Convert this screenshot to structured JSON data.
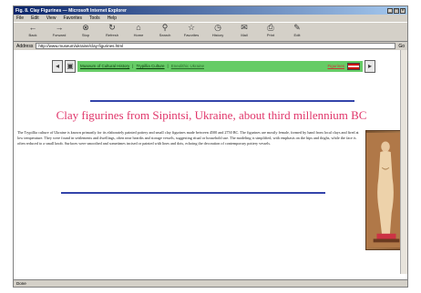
{
  "browser": {
    "title": "Fig. 8. Clay Figurines — Microsoft Internet Explorer",
    "menu": [
      "File",
      "Edit",
      "View",
      "Favorites",
      "Tools",
      "Help"
    ],
    "toolbar": [
      "Back",
      "Forward",
      "Stop",
      "Refresh",
      "Home",
      "Search",
      "Favorites",
      "History",
      "Mail",
      "Print",
      "Edit"
    ],
    "address_label": "Address",
    "address_value": "http://www.museum/ukraine/clay-figurines.html",
    "go_label": "Go",
    "status": "Done"
  },
  "page": {
    "nav": {
      "left_arrow": "◂",
      "home_box": "▣",
      "links": [
        "Museum of Cultural History",
        "Trypillia Culture",
        "Eneolithic Ukraine",
        "Figurines"
      ],
      "right_arrow": "▸",
      "flag_colors": [
        "#cc0000",
        "#ffffff",
        "#cc0000"
      ]
    },
    "heading": "Clay figurines from Sipintsi, Ukraine, about third millennium BC",
    "body": "The Trypillia culture of Ukraine is known primarily for its elaborately painted pottery and small clay figurines made between 4500 and 2750 BC. The figurines are mostly female, formed by hand from local clays and fired at low temperature. They were found in settlements and dwellings, often near hearths and storage vessels, suggesting ritual or household use. The modeling is simplified, with emphasis on the hips and thighs, while the face is often reduced to a small knob. Surfaces were smoothed and sometimes incised or painted with lines and dots, echoing the decoration of contemporary pottery vessels.",
    "image_alt": "Standing clay figurine"
  }
}
